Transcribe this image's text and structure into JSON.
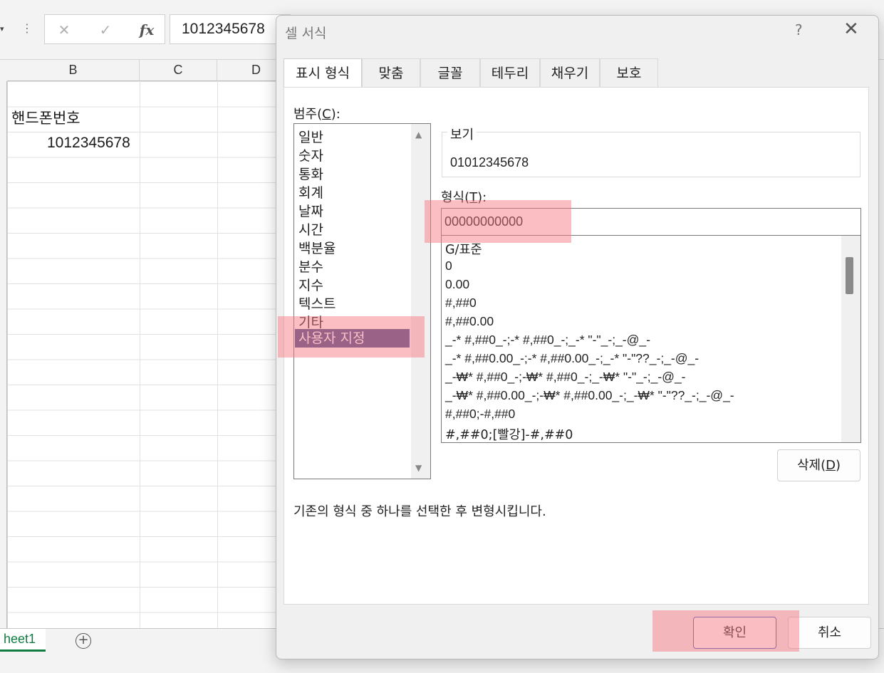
{
  "formula_bar": {
    "value": "1012345678",
    "cancel_icon": "close-icon",
    "enter_icon": "checkmark-icon",
    "fx_label": "fx"
  },
  "spreadsheet": {
    "columns": [
      "B",
      "C",
      "D"
    ],
    "cells": {
      "B2": "핸드폰번호",
      "B3": "1012345678"
    },
    "sheet_tab": "heet1",
    "add_sheet_label": "+"
  },
  "dialog": {
    "title": "셀 서식",
    "help_label": "?",
    "close_label": "✕",
    "tabs": [
      {
        "label": "표시 형식",
        "active": true
      },
      {
        "label": "맞춤"
      },
      {
        "label": "글꼴"
      },
      {
        "label": "테두리"
      },
      {
        "label": "채우기"
      },
      {
        "label": "보호"
      }
    ],
    "category_label": "범주(",
    "category_hotkey": "C",
    "category_label_end": "):",
    "categories": [
      "일반",
      "숫자",
      "통화",
      "회계",
      "날짜",
      "시간",
      "백분율",
      "분수",
      "지수",
      "텍스트",
      "기타",
      "사용자 지정"
    ],
    "selected_category": "사용자 지정",
    "preview_label": "보기",
    "preview_value": "01012345678",
    "format_label": "형식(",
    "format_hotkey": "T",
    "format_label_end": "):",
    "format_value": "00000000000",
    "format_list": [
      "G/표준",
      "0",
      "0.00",
      "#,##0",
      "#,##0.00",
      "_-* #,##0_-;-* #,##0_-;_-* \"-\"_-;_-@_-",
      "_-* #,##0.00_-;-* #,##0.00_-;_-* \"-\"??_-;_-@_-",
      "_-₩* #,##0_-;-₩* #,##0_-;_-₩* \"-\"_-;_-@_-",
      "_-₩* #,##0.00_-;-₩* #,##0.00_-;_-₩* \"-\"??_-;_-@_-",
      "#,##0;-#,##0",
      "#,##0;[빨강]-#,##0"
    ],
    "delete_label": "삭제(",
    "delete_hotkey": "D",
    "delete_label_end": ")",
    "description": "기존의 형식 중 하나를 선택한 후 변형시킵니다.",
    "ok_label": "확인",
    "cancel_label": "취소"
  },
  "highlight_color": "#f5787f"
}
